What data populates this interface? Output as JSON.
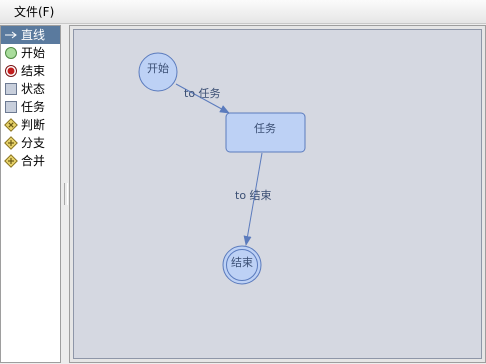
{
  "menu": {
    "file_label": "文件(F)"
  },
  "palette": {
    "items": [
      {
        "label": "直线",
        "icon": "line-arrow-icon"
      },
      {
        "label": "开始",
        "icon": "start-node-icon"
      },
      {
        "label": "结束",
        "icon": "end-node-icon"
      },
      {
        "label": "状态",
        "icon": "state-node-icon"
      },
      {
        "label": "任务",
        "icon": "task-node-icon"
      },
      {
        "label": "判断",
        "icon": "decision-node-icon"
      },
      {
        "label": "分支",
        "icon": "fork-node-icon"
      },
      {
        "label": "合并",
        "icon": "join-node-icon"
      }
    ],
    "selected": "直线"
  },
  "diagram": {
    "nodes": {
      "start": {
        "label": "开始"
      },
      "task": {
        "label": "任务"
      },
      "end": {
        "label": "结束"
      }
    },
    "edges": {
      "start_to_task": {
        "label": "to 任务"
      },
      "task_to_end": {
        "label": "to 结束"
      }
    }
  },
  "colors": {
    "canvas_bg": "#d5d8e1",
    "node_fill": "#bdd1f5",
    "node_stroke": "#5b7bbd",
    "edge": "#5b7bbd",
    "selection": "#5a7a9e"
  }
}
